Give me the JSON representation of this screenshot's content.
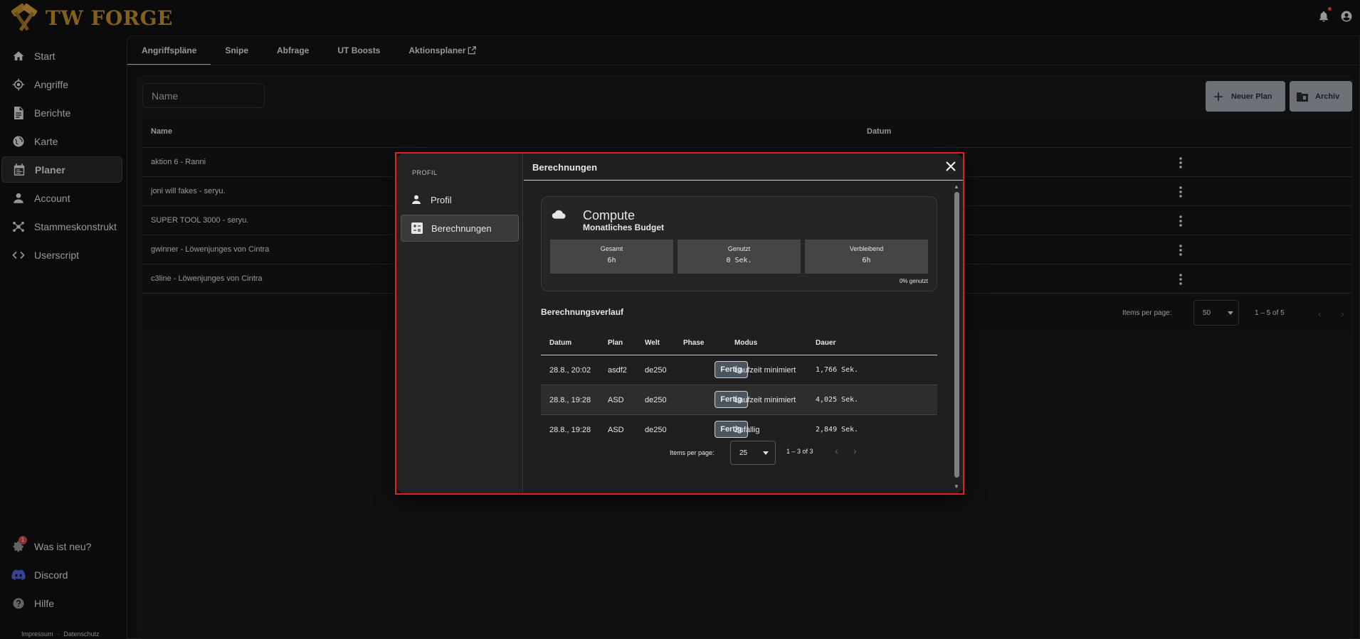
{
  "app": {
    "logo_text": "TW FORGE"
  },
  "sidebar": {
    "items": [
      {
        "label": "Start",
        "icon": "home-icon"
      },
      {
        "label": "Angriffe",
        "icon": "target-icon"
      },
      {
        "label": "Berichte",
        "icon": "document-icon"
      },
      {
        "label": "Karte",
        "icon": "globe-icon"
      },
      {
        "label": "Planer",
        "icon": "calendar-icon",
        "active": true
      },
      {
        "label": "Account",
        "icon": "person-icon"
      },
      {
        "label": "Stammeskonstrukt",
        "icon": "network-icon"
      },
      {
        "label": "Userscript",
        "icon": "code-icon"
      }
    ],
    "bottom_items": [
      {
        "label": "Was ist neu?",
        "icon": "gear-badge-icon",
        "badge": "1"
      },
      {
        "label": "Discord",
        "icon": "discord-icon"
      },
      {
        "label": "Hilfe",
        "icon": "help-icon"
      }
    ],
    "footer": {
      "impressum": "Impressum",
      "separator": "·",
      "datenschutz": "Datenschutz"
    }
  },
  "tabs": [
    "Angriffspläne",
    "Snipe",
    "Abfrage",
    "UT Boosts",
    "Aktionsplaner"
  ],
  "plans": {
    "filter_placeholder": "Name",
    "new_plan_label": "Neuer Plan",
    "archive_label": "Archiv",
    "columns": {
      "name": "Name",
      "date": "Datum"
    },
    "rows": [
      {
        "name": "aktion 6 - Ranni"
      },
      {
        "name": "joni will fakes - seryu."
      },
      {
        "name": "SUPER TOOL 3000 - seryu."
      },
      {
        "name": "gwinner - Löwenjunges von Cintra"
      },
      {
        "name": "c3line - Löwenjunges von Cintra"
      }
    ],
    "pager": {
      "label": "Items per page:",
      "value": "50",
      "range": "1 – 5 of 5"
    }
  },
  "dialog": {
    "side_title": "PROFIL",
    "nav": [
      {
        "label": "Profil",
        "icon": "person-icon"
      },
      {
        "label": "Berechnungen",
        "icon": "calculator-icon",
        "active": true
      }
    ],
    "title": "Berechnungen",
    "compute": {
      "title": "Compute",
      "subtitle": "Monatliches Budget",
      "stats": [
        {
          "label": "Gesamt",
          "value": "6h"
        },
        {
          "label": "Genutzt",
          "value": "0 Sek."
        },
        {
          "label": "Verbleibend",
          "value": "6h"
        }
      ],
      "used_pct": "0% genutzt"
    },
    "history_title": "Berechnungsverlauf",
    "columns": [
      "Datum",
      "Plan",
      "Welt",
      "Phase",
      "Modus",
      "Dauer"
    ],
    "rows": [
      {
        "datum": "28.8., 20:02",
        "plan": "asdf2",
        "welt": "de250",
        "phase": "Fertig",
        "modus": "Laufzeit minimiert",
        "dauer": "1,766 Sek."
      },
      {
        "datum": "28.8., 19:28",
        "plan": "ASD",
        "welt": "de250",
        "phase": "Fertig",
        "modus": "Laufzeit minimiert",
        "dauer": "4,025 Sek."
      },
      {
        "datum": "28.8., 19:28",
        "plan": "ASD",
        "welt": "de250",
        "phase": "Fertig",
        "modus": "Zufällig",
        "dauer": "2,849 Sek."
      }
    ],
    "pager": {
      "label": "Items per page:",
      "value": "25",
      "range": "1 – 3 of 3"
    }
  }
}
